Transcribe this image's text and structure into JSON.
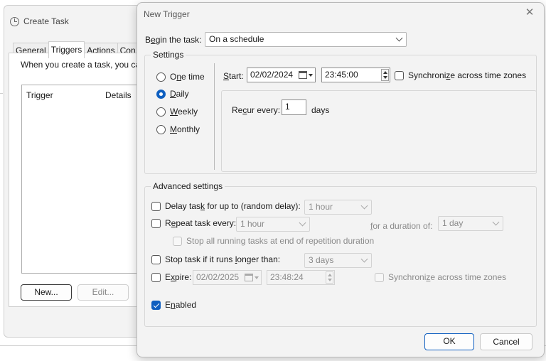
{
  "bg_window": {
    "title": "Create Task",
    "tabs": [
      "General",
      "Triggers",
      "Actions",
      "Con"
    ],
    "description": "When you create a task, you can",
    "columns": [
      "Trigger",
      "Details"
    ],
    "new_label": "New...",
    "edit_label": "Edit..."
  },
  "dialog": {
    "title": "New Trigger",
    "close_icon": "close-icon",
    "begin_label": "Begin the task:",
    "begin_value": "On a schedule",
    "settings": {
      "title": "Settings",
      "options": [
        {
          "label": "One time",
          "selected": false
        },
        {
          "label": "Daily",
          "selected": true
        },
        {
          "label": "Weekly",
          "selected": false
        },
        {
          "label": "Monthly",
          "selected": false
        }
      ],
      "start_label": "Start:",
      "start_date": "02/02/2024",
      "start_time": "23:45:00",
      "sync_label": "Synchronize across time zones",
      "sync_checked": false,
      "recur_label": "Recur every:",
      "recur_value": "1",
      "recur_unit": "days"
    },
    "advanced": {
      "title": "Advanced settings",
      "delay_label": "Delay task for up to (random delay):",
      "delay_value": "1 hour",
      "delay_checked": false,
      "repeat_label": "Repeat task every:",
      "repeat_value": "1 hour",
      "repeat_checked": false,
      "duration_label": "for a duration of:",
      "duration_value": "1 day",
      "stop_all_label": "Stop all running tasks at end of repetition duration",
      "stop_if_label": "Stop task if it runs longer than:",
      "stop_if_value": "3 days",
      "stop_if_checked": false,
      "expire_label": "Expire:",
      "expire_date": "02/02/2025",
      "expire_time": "23:48:24",
      "expire_checked": false,
      "expire_sync_label": "Synchronize across time zones",
      "enabled_label": "Enabled",
      "enabled_checked": true
    },
    "ok_label": "OK",
    "cancel_label": "Cancel"
  },
  "colors": {
    "accent": "#0f5fc0",
    "dialog_bg": "#f3f3f3"
  }
}
